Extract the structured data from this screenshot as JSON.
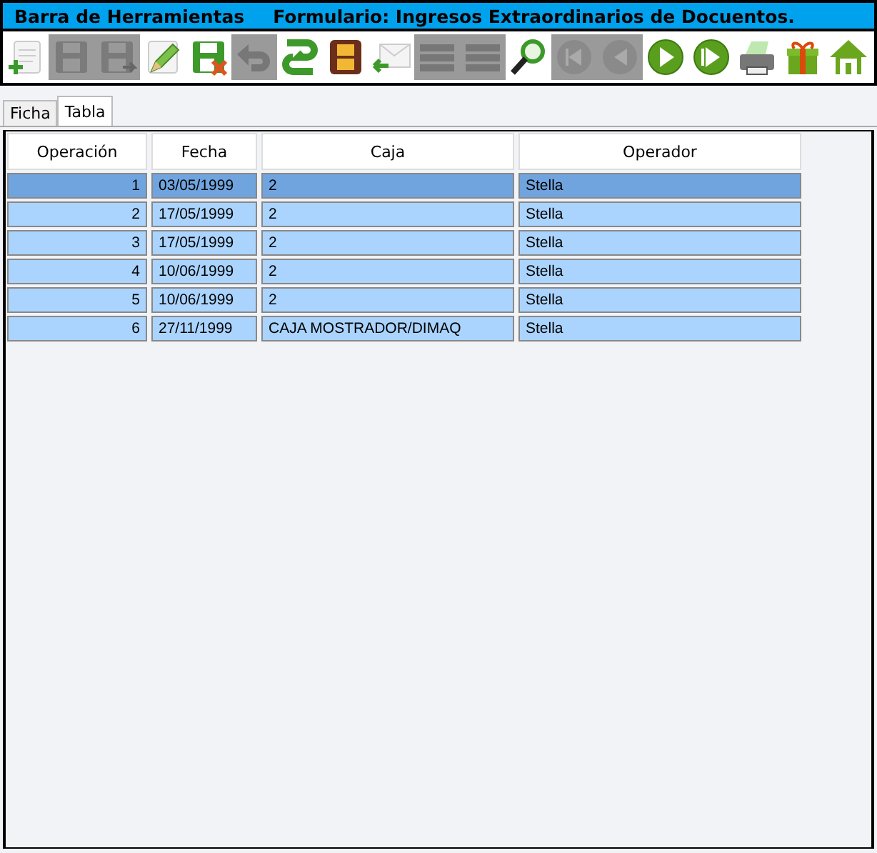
{
  "title_bar": {
    "left": "Barra de Herramientas",
    "right": "Formulario: Ingresos Extraordinarios de Docuentos."
  },
  "toolbar": [
    {
      "kind": "new",
      "disabled": false
    },
    {
      "kind": "save",
      "disabled": true
    },
    {
      "kind": "saveas",
      "disabled": true
    },
    {
      "kind": "edit",
      "disabled": false
    },
    {
      "kind": "delete",
      "disabled": false
    },
    {
      "kind": "undo",
      "disabled": true
    },
    {
      "kind": "refresh",
      "disabled": false
    },
    {
      "kind": "film",
      "disabled": false
    },
    {
      "kind": "mail",
      "disabled": false
    },
    {
      "kind": "list",
      "disabled": true
    },
    {
      "kind": "list",
      "disabled": true
    },
    {
      "kind": "search",
      "disabled": false
    },
    {
      "kind": "first",
      "disabled": true
    },
    {
      "kind": "prev",
      "disabled": true
    },
    {
      "kind": "next",
      "disabled": false
    },
    {
      "kind": "last",
      "disabled": false
    },
    {
      "kind": "print",
      "disabled": false
    },
    {
      "kind": "gift",
      "disabled": false
    },
    {
      "kind": "home",
      "disabled": false
    }
  ],
  "tabs": [
    {
      "label": "Ficha",
      "selected": false
    },
    {
      "label": "Tabla",
      "selected": true
    }
  ],
  "table": {
    "columns": [
      "Operación",
      "Fecha",
      "Caja",
      "Operador"
    ],
    "rows": [
      {
        "cells": [
          "1",
          "03/05/1999",
          "2",
          "Stella"
        ],
        "selected": true
      },
      {
        "cells": [
          "2",
          "17/05/1999",
          "2",
          "Stella"
        ],
        "selected": false
      },
      {
        "cells": [
          "3",
          "17/05/1999",
          "2",
          "Stella"
        ],
        "selected": false
      },
      {
        "cells": [
          "4",
          "10/06/1999",
          "2",
          "Stella"
        ],
        "selected": false
      },
      {
        "cells": [
          "5",
          "10/06/1999",
          "2",
          "Stella"
        ],
        "selected": false
      },
      {
        "cells": [
          "6",
          "27/11/1999",
          "CAJA MOSTRADOR/DIMAQ",
          "Stella"
        ],
        "selected": false
      }
    ]
  }
}
